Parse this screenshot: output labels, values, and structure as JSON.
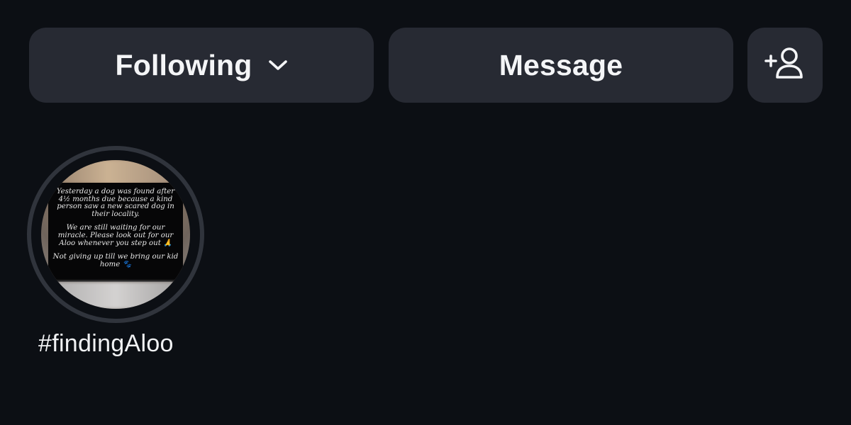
{
  "actions": {
    "following_label": "Following",
    "message_label": "Message",
    "add_user_icon": "person-plus-icon",
    "dropdown_icon": "chevron-down-icon"
  },
  "highlights": [
    {
      "label": "#findingAloo",
      "cover_text": {
        "p1": "Yesterday a dog was found after 4½ months due because a kind person saw a new scared dog in their locality.",
        "p2": "We are still waiting for our miracle. Please look out for our Aloo whenever you step out 🙏",
        "p3": "Not giving up till we bring our kid home 🐾"
      }
    }
  ],
  "colors": {
    "background": "#0c0f14",
    "button_bg": "#272a33",
    "text": "#f4f5f7"
  }
}
